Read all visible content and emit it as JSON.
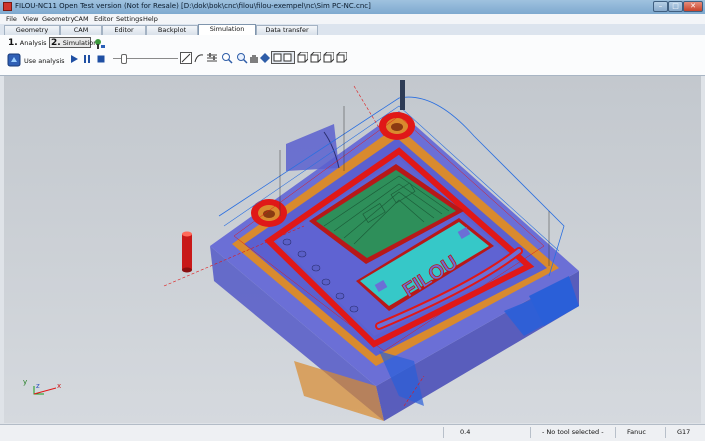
{
  "window": {
    "title": "FILOU-NC11 Open Test version (Not for Resale)  [D:\\dok\\bok\\cnc\\filou\\filou-exempel\\nc\\Sim PC-NC.cnc]",
    "controls": {
      "minimize": "–",
      "maximize": "□",
      "close": "✕"
    }
  },
  "menu": [
    "File",
    "View",
    "Geometry",
    "CAM",
    "Editor",
    "Settings",
    "Help"
  ],
  "tabs": [
    "Geometry",
    "CAM",
    "Editor",
    "Backplot",
    "Simulation",
    "Data transfer"
  ],
  "active_tab": "Simulation",
  "ribbon": {
    "step1_number": "1.",
    "step1_label": "Analysis",
    "step2_number": "2.",
    "step2_label": "Simulation",
    "use_analysis": "Use analysis"
  },
  "status": {
    "value": "0.4",
    "tool": "- No tool selected -",
    "control": "Fanuc",
    "gcode": "G17"
  },
  "axes": {
    "x": "x",
    "y": "y",
    "z": "z"
  },
  "part_text": "FILOU",
  "colors": {
    "stock": "#6b6fd6",
    "wall": "#d98a2e",
    "pocket": "#2e8f5a",
    "engrave": "#36c8c8",
    "toolpath": "#e01818",
    "toolpath_blue": "#2a6fe0"
  }
}
